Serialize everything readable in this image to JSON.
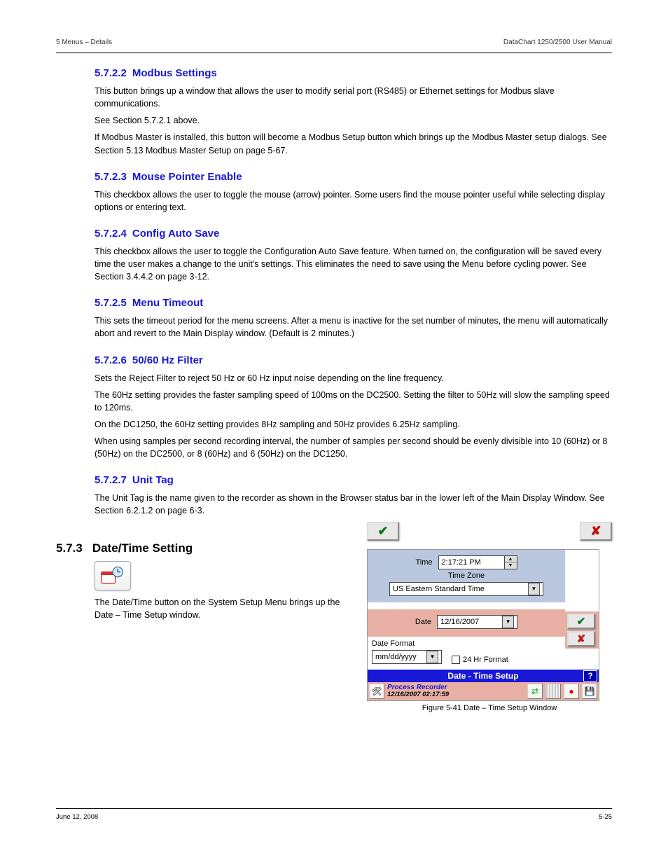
{
  "header": {
    "left": "5 Menus – Details",
    "right": "DataChart 1250/2500 User Manual"
  },
  "sections": [
    {
      "num": "5.7.2.2",
      "title": "Modbus Settings",
      "paras": [
        "This button brings up a window that allows the user to modify serial port (RS485) or Ethernet settings for Modbus slave communications.",
        "See Section 5.7.2.1 above.",
        "If Modbus Master is installed, this button will become a Modbus Setup button which brings up the Modbus Master setup dialogs. See Section 5.13 Modbus Master Setup on page 5-67."
      ]
    },
    {
      "num": "5.7.2.3",
      "title": "Mouse Pointer Enable",
      "paras": [
        "This checkbox allows the user to toggle the mouse (arrow) pointer. Some users find the mouse pointer useful while selecting display options or entering text."
      ]
    },
    {
      "num": "5.7.2.4",
      "title": "Config Auto Save",
      "paras": [
        "This checkbox allows the user to toggle the Configuration Auto Save feature. When turned on, the configuration will be saved every time the user makes a change to the unit's settings. This eliminates the need to save using the Menu before cycling power. See Section 3.4.4.2 on page 3-12."
      ],
      "link": {
        "text": "Section",
        "after": " 3.4.4.2 on page 3-12."
      }
    },
    {
      "num": "5.7.2.5",
      "title": "Menu Timeout",
      "paras": [
        "This sets the timeout period for the menu screens. After a menu is inactive for the set number of minutes, the menu will automatically abort and revert to the Main Display window. (Default is 2 minutes.)"
      ]
    },
    {
      "num": "5.7.2.6",
      "title": "50/60 Hz Filter",
      "paras": [
        "Sets the Reject Filter to reject 50 Hz or 60 Hz input noise depending on the line frequency.",
        "The 60Hz setting provides the faster sampling speed of 100ms on the DC2500.  Setting the filter to 50Hz will slow the sampling speed to 120ms.",
        "On the DC1250, the 60Hz setting provides 8Hz sampling and 50Hz provides 6.25Hz sampling.",
        "When using samples per second recording interval, the number of samples per second should be evenly divisible into 10 (60Hz) or 8 (50Hz) on the DC2500, or 8 (60Hz) and 6 (50Hz) on the DC1250."
      ]
    },
    {
      "num": "5.7.2.7",
      "title": "Unit Tag",
      "paras": [
        "The Unit Tag is the name given to the recorder as shown in the Browser status bar in the lower left of the Main Display Window. See Section 6.2.1.2 on page 6-3."
      ],
      "link": {
        "text": "6.2.1.2",
        "pre": "See Section "
      }
    }
  ],
  "main": {
    "num": "5.7.3",
    "title": "Date/Time Setting",
    "paras": [
      "The Date/Time button on the System Setup Menu brings up the Date – Time Setup window."
    ]
  },
  "dialog": {
    "check": "✔",
    "x": "✘",
    "time_label": "Time",
    "time_value": "2:17:21 PM",
    "tz_label": "Time Zone",
    "tz_value": "US Eastern Standard Time",
    "date_label": "Date",
    "date_value": "12/16/2007",
    "fmt_label": "Date Format",
    "fmt_value": "mm/dd/yyyy",
    "chk24": "24 Hr Format",
    "title": "Date - Time Setup",
    "status_name": "Process Recorder",
    "status_time": "12/16/2007 02:17:59",
    "help": "?",
    "caption": "Figure 5-41 Date – Time Setup Window"
  },
  "footer": {
    "left": "June 12, 2008",
    "right": "5-25"
  }
}
